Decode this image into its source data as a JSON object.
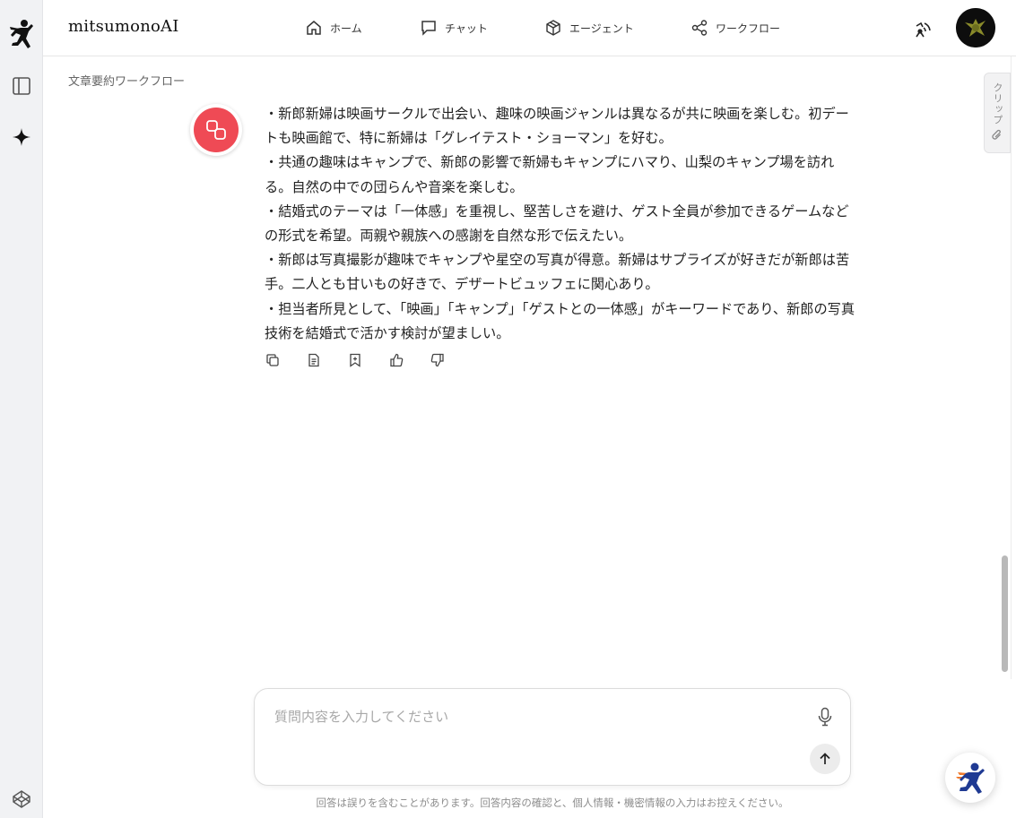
{
  "app": {
    "brand": "mitsumonoAI"
  },
  "nav": [
    {
      "label": "ホーム",
      "icon": "home-icon"
    },
    {
      "label": "チャット",
      "icon": "chat-icon"
    },
    {
      "label": "エージェント",
      "icon": "cube-icon"
    },
    {
      "label": "ワークフロー",
      "icon": "share-icon"
    }
  ],
  "breadcrumb": "文章要約ワークフロー",
  "message": {
    "lines": [
      "・新郎新婦は映画サークルで出会い、趣味の映画ジャンルは異なるが共に映画を楽しむ。初デートも映画館で、特に新婦は「グレイテスト・ショーマン」を好む。",
      "・共通の趣味はキャンプで、新郎の影響で新婦もキャンプにハマり、山梨のキャンプ場を訪れる。自然の中での団らんや音楽を楽しむ。",
      "・結婚式のテーマは「一体感」を重視し、堅苦しさを避け、ゲスト全員が参加できるゲームなどの形式を希望。両親や親族への感謝を自然な形で伝えたい。",
      "・新郎は写真撮影が趣味でキャンプや星空の写真が得意。新婦はサプライズが好きだが新郎は苦手。二人とも甘いもの好きで、デザートビュッフェに関心あり。",
      "・担当者所見として、「映画」「キャンプ」「ゲストとの一体感」がキーワードであり、新郎の写真技術を結婚式で活かす検討が望ましい。"
    ],
    "actions": [
      "copy-icon",
      "document-icon",
      "bookmark-add-icon",
      "thumbs-up-icon",
      "thumbs-down-icon"
    ]
  },
  "clip_tab": {
    "label": "クリップ"
  },
  "composer": {
    "placeholder": "質問内容を入力してください",
    "value": ""
  },
  "disclaimer": "回答は誤りを含むことがあります。回答内容の確認と、個人情報・機密情報の入力はお控えください。",
  "colors": {
    "accent_red": "#ef4a55",
    "rail_bg": "#f1f2f4"
  }
}
